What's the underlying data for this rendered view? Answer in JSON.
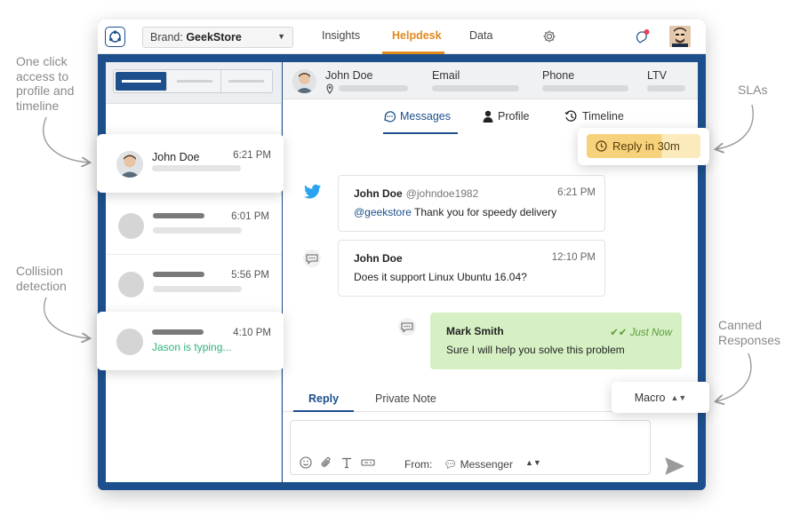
{
  "annotations": {
    "profile": [
      "One click",
      "access to",
      "profile and",
      "timeline"
    ],
    "collision": [
      "Collision",
      "detection"
    ],
    "slas": [
      "SLAs"
    ],
    "canned": [
      "Canned",
      "Responses"
    ]
  },
  "topbar": {
    "brand_prefix": "Brand:",
    "brand_value": "GeekStore",
    "nav": [
      "Insights",
      "Helpdesk",
      "Data"
    ],
    "active_nav": "Helpdesk"
  },
  "conversations": [
    {
      "name": "John Doe",
      "time": "6:21 PM",
      "status": ""
    },
    {
      "name": "",
      "time": "6:01 PM",
      "status": ""
    },
    {
      "name": "",
      "time": "5:56 PM",
      "status": ""
    },
    {
      "name": "",
      "time": "4:10 PM",
      "status": "Jason is typing..."
    }
  ],
  "profile_strip": {
    "name": "John Doe",
    "fields": [
      "Email",
      "Phone",
      "LTV"
    ]
  },
  "tabs": [
    "Messages",
    "Profile",
    "Timeline"
  ],
  "sla": {
    "label": "Reply in 30m"
  },
  "messages": [
    {
      "channel": "twitter-icon",
      "from": "John Doe",
      "handle": "@johndoe1982",
      "time": "6:21 PM",
      "mention": "@geekstore",
      "body": " Thank you for speedy delivery"
    },
    {
      "channel": "chat-icon",
      "from": "John Doe",
      "handle": "",
      "time": "12:10 PM",
      "mention": "",
      "body": "Does it support Linux Ubuntu 16.04?"
    },
    {
      "channel": "chat-icon",
      "from": "Mark Smith",
      "handle": "",
      "time": "Just Now",
      "mention": "",
      "body": "Sure I will help you solve this problem"
    }
  ],
  "reply": {
    "tabs": [
      "Reply",
      "Private Note"
    ],
    "from_label": "From:",
    "from_value": "Messenger"
  },
  "macro": {
    "label": "Macro"
  },
  "colors": {
    "brand": "#1d4f8c",
    "accent": "#e08a1e",
    "typing": "#2fb37b",
    "agent_bubble": "#d6f0c4",
    "sla": "#f6d27c"
  }
}
